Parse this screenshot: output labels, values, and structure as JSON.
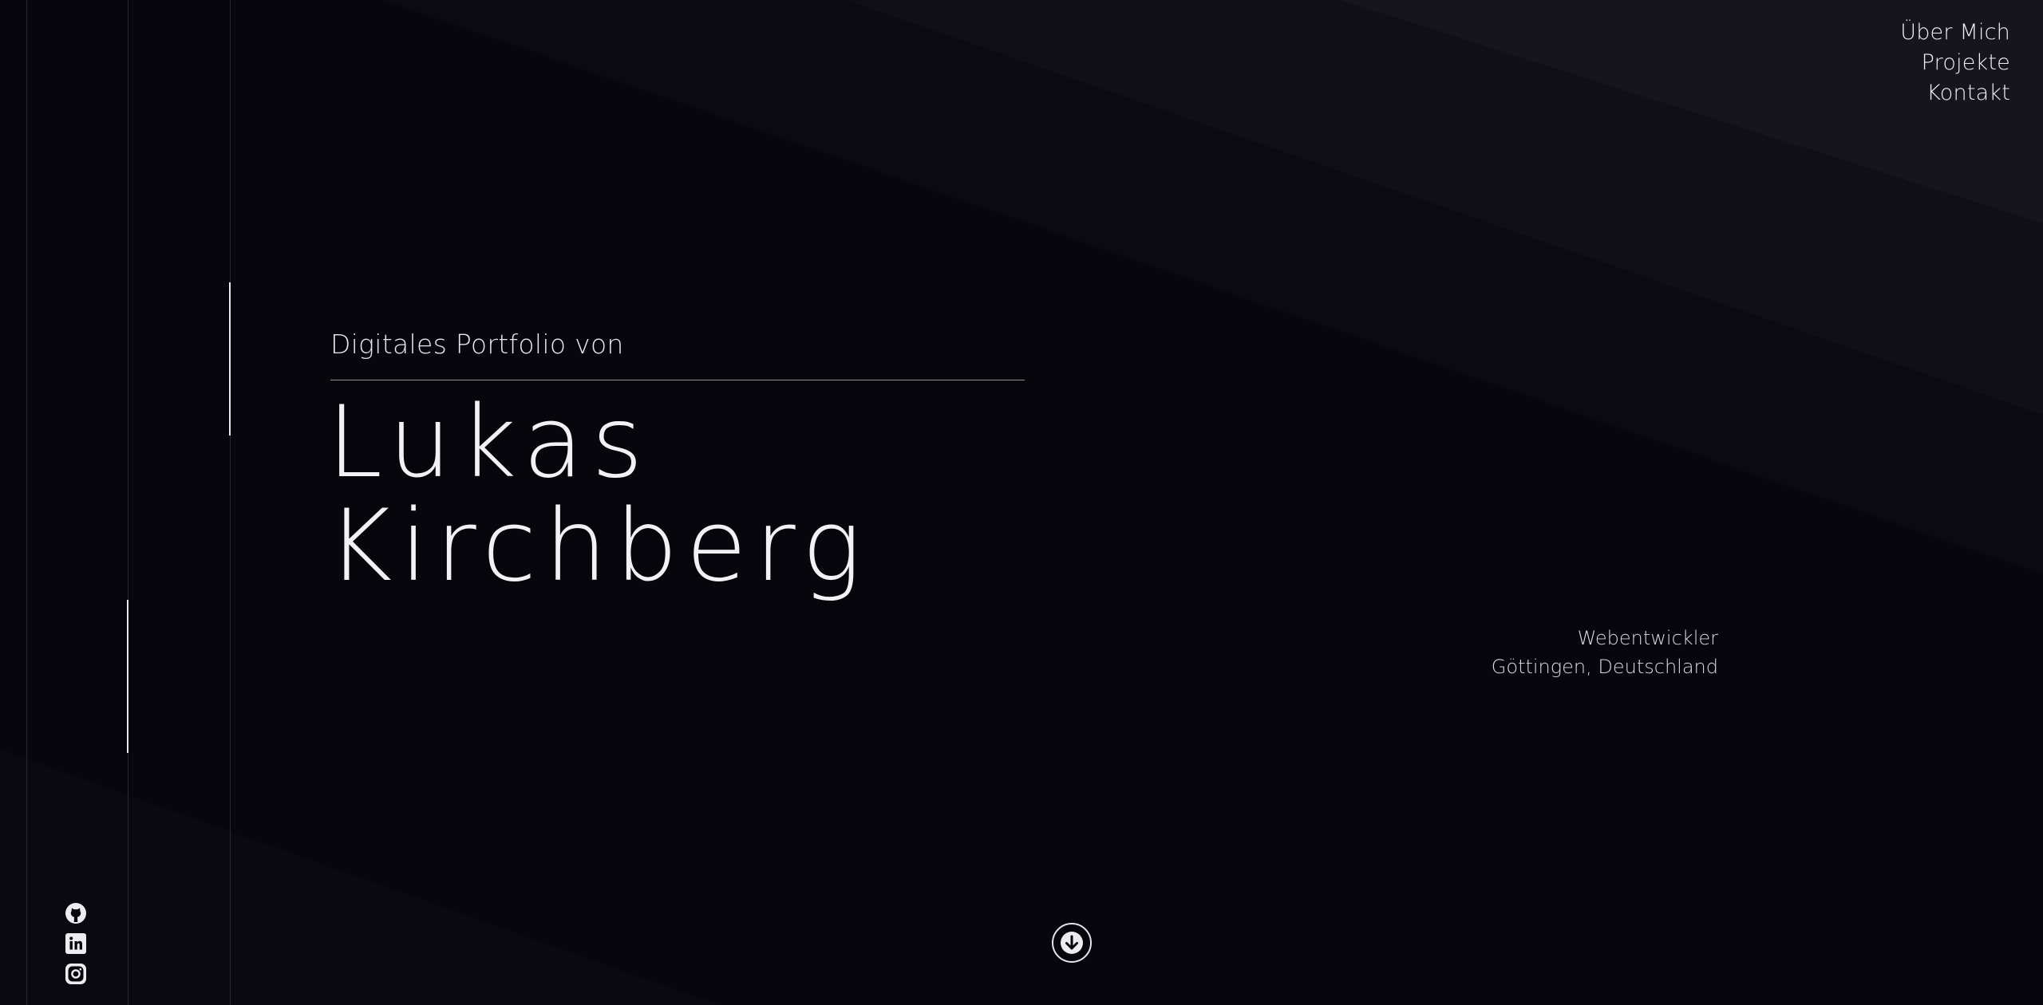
{
  "nav": {
    "items": [
      {
        "label": "Über Mich"
      },
      {
        "label": "Projekte"
      },
      {
        "label": "Kontakt"
      }
    ]
  },
  "hero": {
    "intro": "Digitales Portfolio von",
    "first_name": "Lukas",
    "last_name": "Kirchberg",
    "role": "Webentwickler",
    "location": "Göttingen, Deutschland"
  },
  "social": {
    "icons": [
      "github-icon",
      "linkedin-icon",
      "instagram-icon"
    ]
  },
  "scroll": {
    "icon": "arrow-down-icon"
  },
  "colors": {
    "background": "#07060d",
    "text": "#f4f1f5",
    "accent_line": "#e9e6ee"
  }
}
